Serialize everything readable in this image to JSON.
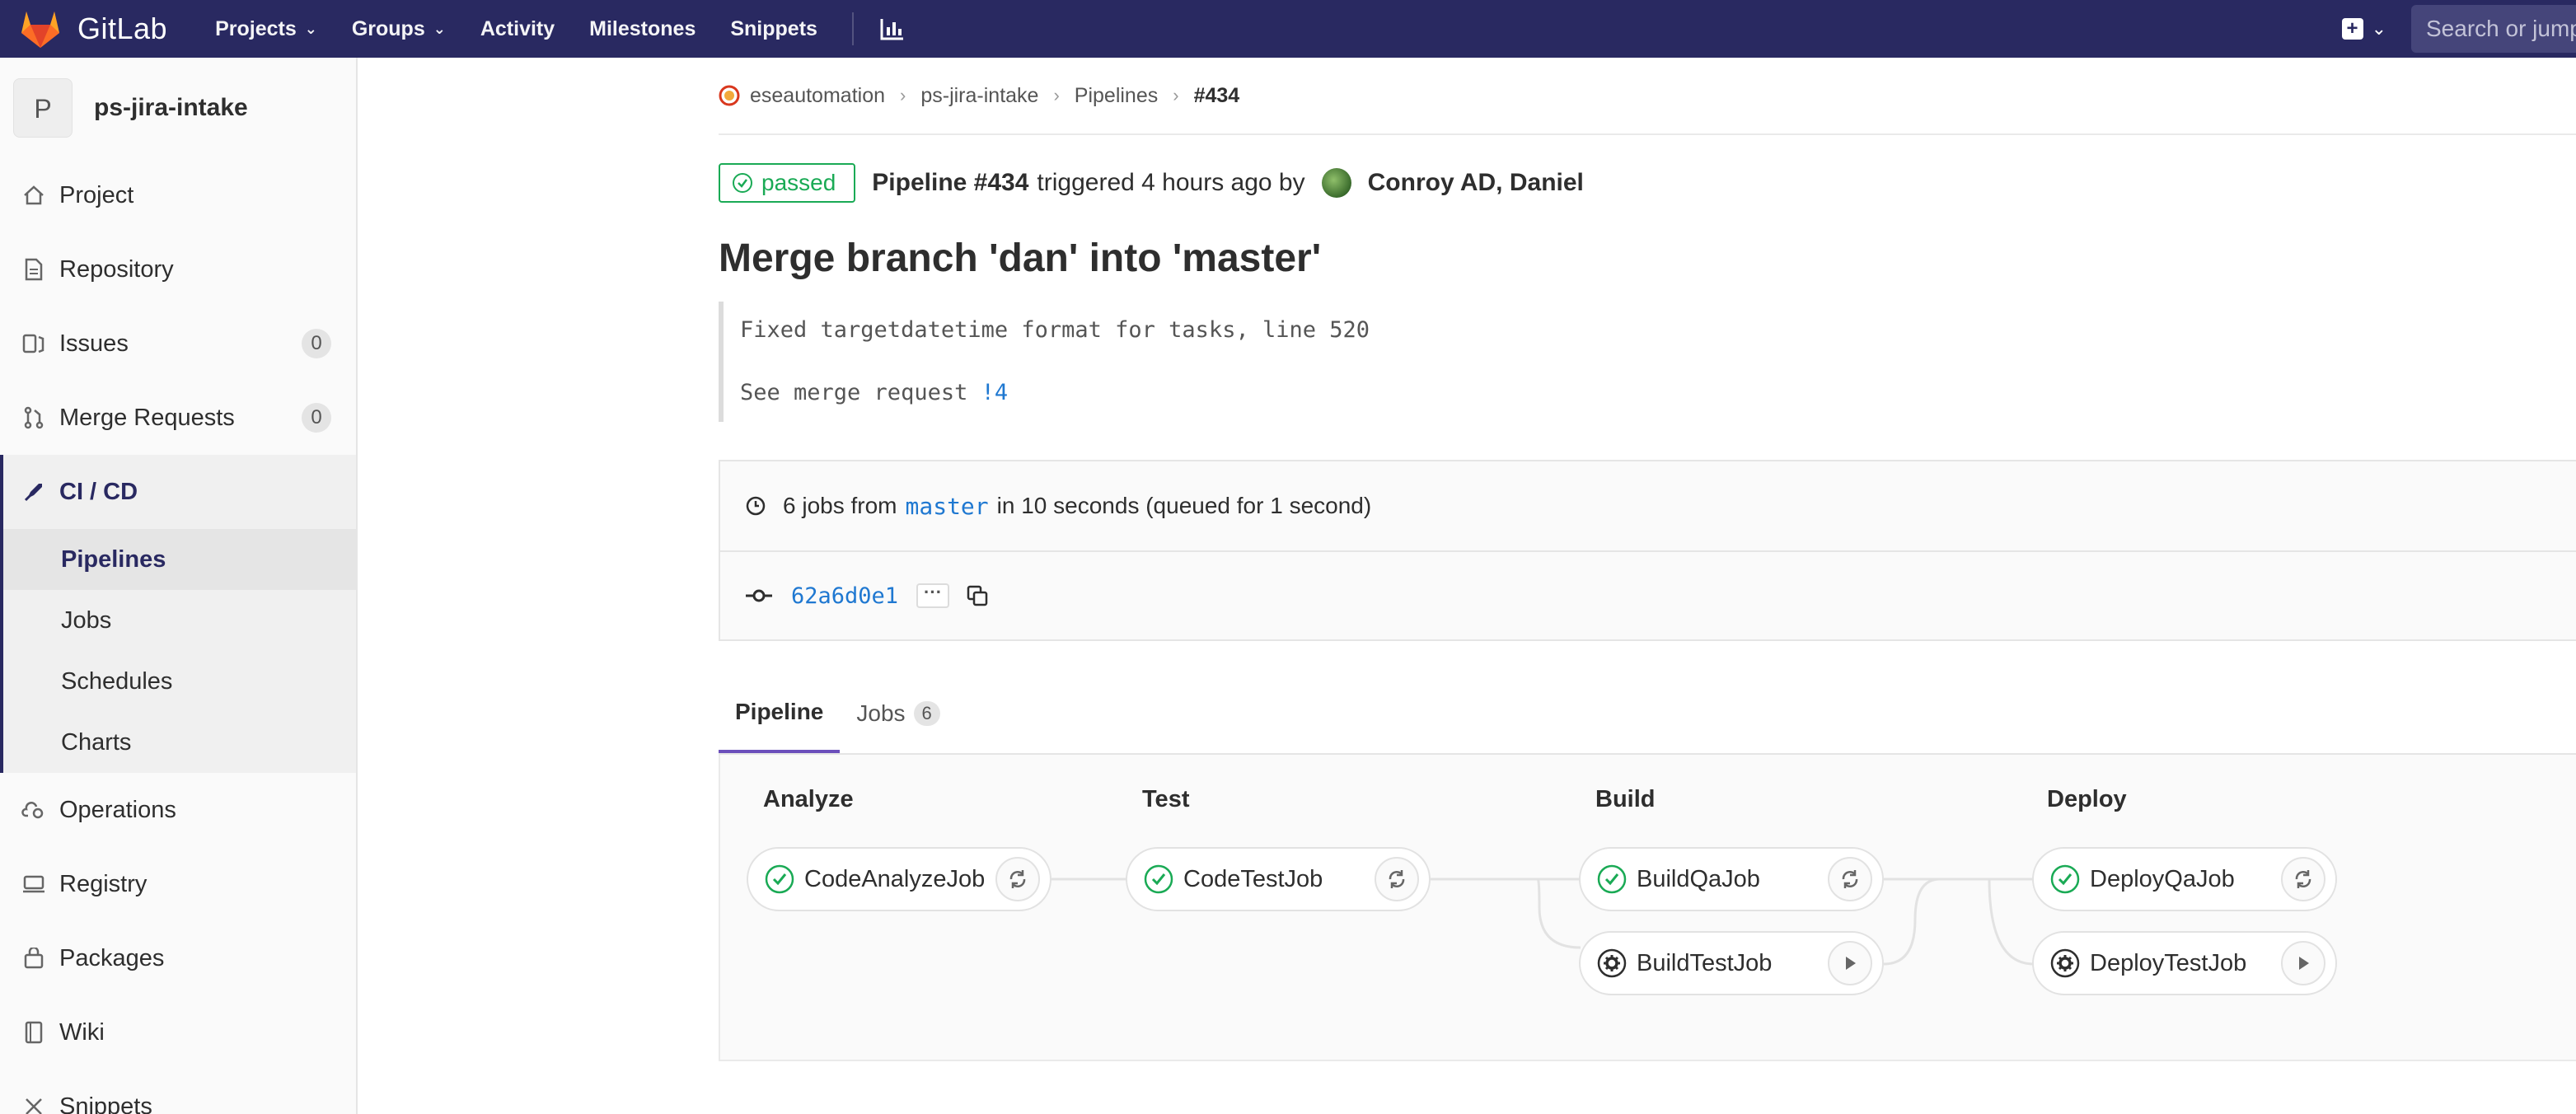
{
  "navbar": {
    "brand": "GitLab",
    "links": [
      {
        "label": "Projects",
        "dropdown": true
      },
      {
        "label": "Groups",
        "dropdown": true
      },
      {
        "label": "Activity",
        "dropdown": false
      },
      {
        "label": "Milestones",
        "dropdown": false
      },
      {
        "label": "Snippets",
        "dropdown": false
      }
    ],
    "chart_icon": "chart-icon",
    "new_icon": "plus-square-icon",
    "search_placeholder": "Search or jump to…",
    "colors": {
      "navbar_bg": "#292961",
      "accent": "#6b4fbb",
      "success": "#1aaa55",
      "link": "#1f78d1"
    }
  },
  "sidebar": {
    "avatar_letter": "P",
    "project_name": "ps-jira-intake",
    "items": [
      {
        "label": "Project",
        "icon": "home-icon"
      },
      {
        "label": "Repository",
        "icon": "doc-icon"
      },
      {
        "label": "Issues",
        "icon": "issues-icon",
        "count": "0"
      },
      {
        "label": "Merge Requests",
        "icon": "merge-icon",
        "count": "0"
      },
      {
        "label": "CI / CD",
        "icon": "rocket-icon",
        "active": true
      },
      {
        "label": "Operations",
        "icon": "cloud-gear-icon"
      },
      {
        "label": "Registry",
        "icon": "registry-icon"
      },
      {
        "label": "Packages",
        "icon": "package-icon"
      },
      {
        "label": "Wiki",
        "icon": "book-icon"
      },
      {
        "label": "Snippets",
        "icon": "scissors-icon"
      }
    ],
    "sub_items": [
      {
        "label": "Pipelines",
        "current": true
      },
      {
        "label": "Jobs"
      },
      {
        "label": "Schedules"
      },
      {
        "label": "Charts"
      }
    ]
  },
  "breadcrumb": {
    "items": [
      "eseautomation",
      "ps-jira-intake",
      "Pipelines"
    ],
    "current": "#434"
  },
  "pipeline": {
    "status": "passed",
    "title_bold": "Pipeline #434",
    "triggered_text": "triggered 4 hours ago by",
    "user": "Conroy AD, Daniel"
  },
  "commit": {
    "title": "Merge branch 'dan' into 'master'",
    "line1": "Fixed targetdatetime format for tasks, line 520",
    "line2_prefix": "See merge request ",
    "mr_link": "!4"
  },
  "info": {
    "jobs_prefix": "6 jobs from",
    "ref": "master",
    "jobs_suffix": "in 10 seconds (queued for 1 second)",
    "sha": "62a6d0e1",
    "ellipsis": "···"
  },
  "tabs": [
    {
      "label": "Pipeline",
      "active": true
    },
    {
      "label": "Jobs",
      "badge": "6"
    }
  ],
  "stages": [
    {
      "name": "Analyze",
      "jobs": [
        {
          "name": "CodeAnalyzeJob",
          "status": "success",
          "action": "retry"
        }
      ]
    },
    {
      "name": "Test",
      "jobs": [
        {
          "name": "CodeTestJob",
          "status": "success",
          "action": "retry"
        }
      ]
    },
    {
      "name": "Build",
      "jobs": [
        {
          "name": "BuildQaJob",
          "status": "success",
          "action": "retry"
        },
        {
          "name": "BuildTestJob",
          "status": "manual",
          "action": "play"
        }
      ]
    },
    {
      "name": "Deploy",
      "jobs": [
        {
          "name": "DeployQaJob",
          "status": "success",
          "action": "retry"
        },
        {
          "name": "DeployTestJob",
          "status": "manual",
          "action": "play"
        }
      ]
    }
  ]
}
